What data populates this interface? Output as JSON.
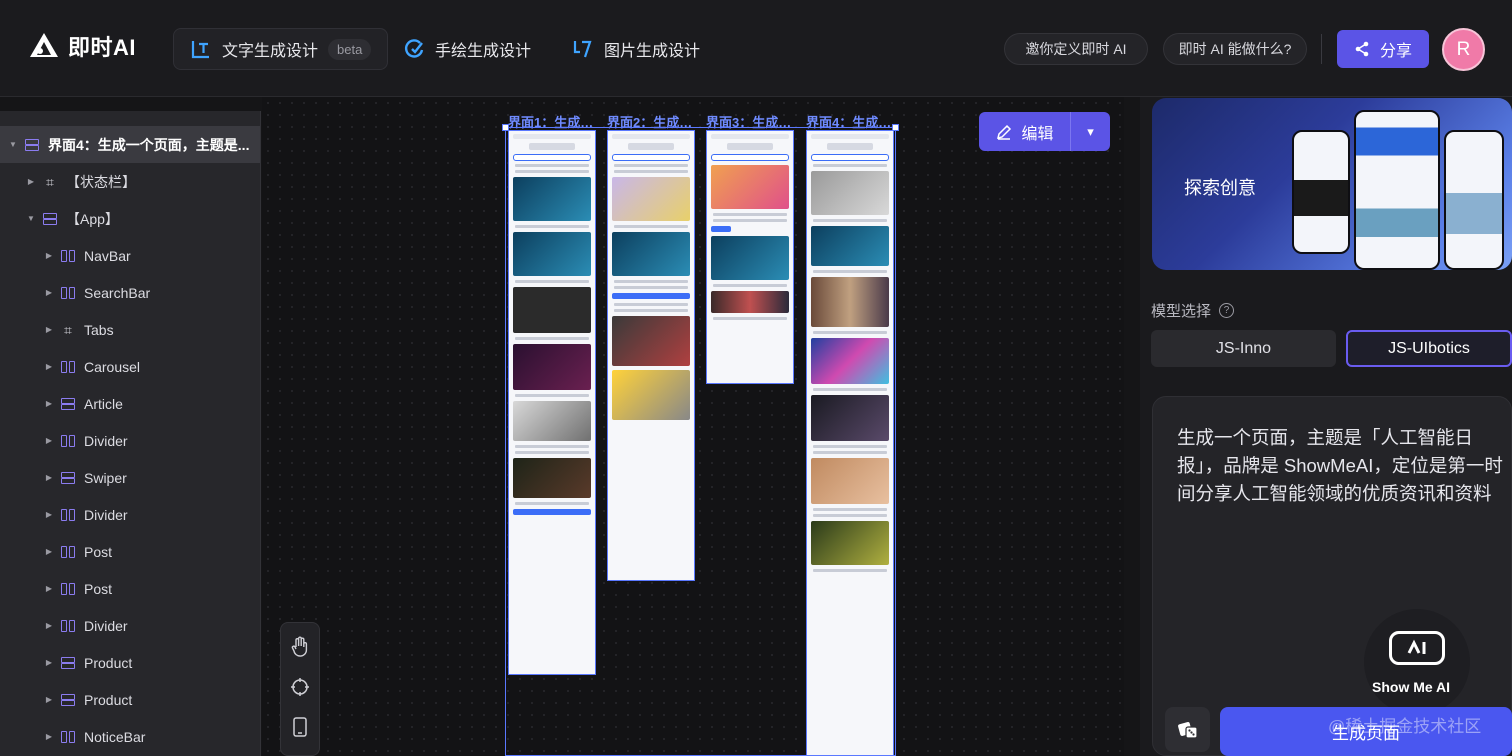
{
  "app": {
    "logo_text": "即时AI"
  },
  "nav": {
    "tabs": [
      {
        "label": "文字生成设计",
        "badge": "beta",
        "active": true,
        "icon": "text-gen-icon"
      },
      {
        "label": "手绘生成设计",
        "active": false,
        "icon": "sketch-gen-icon"
      },
      {
        "label": "图片生成设计",
        "active": false,
        "icon": "image-gen-icon"
      }
    ],
    "invite_label": "邀你定义即时 AI",
    "capabilities_label": "即时 AI 能做什么?",
    "share_label": "分享",
    "avatar_letter": "R"
  },
  "layer_tree": {
    "items": [
      {
        "label": "界面4：生成一个页面，主题是...",
        "icon": "stack",
        "expanded": true,
        "selected": true
      },
      {
        "label": "【状态栏】",
        "icon": "frame"
      },
      {
        "label": "【App】",
        "icon": "stack",
        "expanded": true
      },
      {
        "label": "NavBar",
        "icon": "cols"
      },
      {
        "label": "SearchBar",
        "icon": "cols"
      },
      {
        "label": "Tabs",
        "icon": "frame"
      },
      {
        "label": "Carousel",
        "icon": "cols"
      },
      {
        "label": "Article",
        "icon": "stack"
      },
      {
        "label": "Divider",
        "icon": "cols"
      },
      {
        "label": "Swiper",
        "icon": "stack"
      },
      {
        "label": "Divider",
        "icon": "cols"
      },
      {
        "label": "Post",
        "icon": "cols"
      },
      {
        "label": "Post",
        "icon": "cols"
      },
      {
        "label": "Divider",
        "icon": "cols"
      },
      {
        "label": "Product",
        "icon": "stack"
      },
      {
        "label": "Product",
        "icon": "stack"
      },
      {
        "label": "NoticeBar",
        "icon": "cols"
      }
    ]
  },
  "canvas": {
    "screens": [
      {
        "label": "界面1：生成…"
      },
      {
        "label": "界面2：生成…"
      },
      {
        "label": "界面3：生成…"
      },
      {
        "label": "界面4：生成…"
      }
    ],
    "edit_label": "编辑",
    "tools": [
      "hand-icon",
      "crosshair-icon",
      "phone-icon"
    ]
  },
  "right_panel": {
    "banner_text": "探索创意",
    "model_label": "模型选择",
    "models": [
      {
        "label": "JS-Inno",
        "selected": false
      },
      {
        "label": "JS-UIbotics",
        "selected": true
      }
    ],
    "prompt": "生成一个页面，主题是「人工智能日报」，品牌是 ShowMeAI，定位是第一时间分享人工智能领域的优质资讯和资料",
    "generate_label": "生成页面",
    "bot_label": "Show Me AI",
    "watermark": "@稀土掘金技术社区"
  },
  "colors": {
    "accent": "#5b54e6",
    "selection": "#5a78ff",
    "avatar": "#f07aa8"
  }
}
